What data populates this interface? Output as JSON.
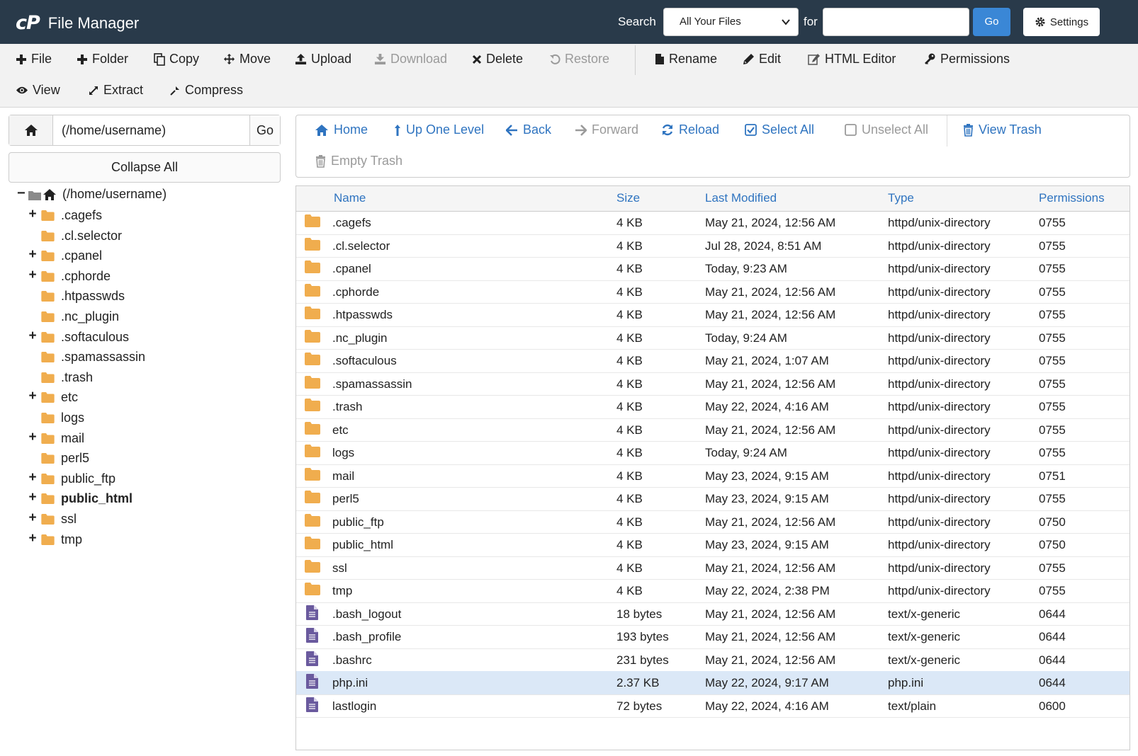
{
  "header": {
    "logo": "cP",
    "title": "File Manager",
    "search_label": "Search",
    "search_scope": "All Your Files",
    "for_label": "for",
    "search_value": "",
    "go_label": "Go",
    "settings_label": "Settings"
  },
  "toolbar": {
    "file": "File",
    "folder": "Folder",
    "copy": "Copy",
    "move": "Move",
    "upload": "Upload",
    "download": "Download",
    "delete": "Delete",
    "restore": "Restore",
    "rename": "Rename",
    "edit": "Edit",
    "html_editor": "HTML Editor",
    "permissions": "Permissions",
    "view": "View",
    "extract": "Extract",
    "compress": "Compress"
  },
  "sidebar": {
    "path_value": "(/home/username)",
    "go_label": "Go",
    "collapse_label": "Collapse All",
    "root_label": "(/home/username)",
    "tree": [
      {
        "label": ".cagefs",
        "expandable": true,
        "bold": false
      },
      {
        "label": ".cl.selector",
        "expandable": false,
        "bold": false
      },
      {
        "label": ".cpanel",
        "expandable": true,
        "bold": false
      },
      {
        "label": ".cphorde",
        "expandable": true,
        "bold": false
      },
      {
        "label": ".htpasswds",
        "expandable": false,
        "bold": false
      },
      {
        "label": ".nc_plugin",
        "expandable": false,
        "bold": false
      },
      {
        "label": ".softaculous",
        "expandable": true,
        "bold": false
      },
      {
        "label": ".spamassassin",
        "expandable": false,
        "bold": false
      },
      {
        "label": ".trash",
        "expandable": false,
        "bold": false
      },
      {
        "label": "etc",
        "expandable": true,
        "bold": false
      },
      {
        "label": "logs",
        "expandable": false,
        "bold": false
      },
      {
        "label": "mail",
        "expandable": true,
        "bold": false
      },
      {
        "label": "perl5",
        "expandable": false,
        "bold": false
      },
      {
        "label": "public_ftp",
        "expandable": true,
        "bold": false
      },
      {
        "label": "public_html",
        "expandable": true,
        "bold": true
      },
      {
        "label": "ssl",
        "expandable": true,
        "bold": false
      },
      {
        "label": "tmp",
        "expandable": true,
        "bold": false
      }
    ]
  },
  "nav": {
    "home": "Home",
    "up_one_level": "Up One Level",
    "back": "Back",
    "forward": "Forward",
    "reload": "Reload",
    "select_all": "Select All",
    "unselect_all": "Unselect All",
    "view_trash": "View Trash",
    "empty_trash": "Empty Trash"
  },
  "table": {
    "columns": {
      "name": "Name",
      "size": "Size",
      "modified": "Last Modified",
      "type": "Type",
      "permissions": "Permissions"
    },
    "rows": [
      {
        "icon": "folder-icon",
        "name": ".cagefs",
        "size": "4 KB",
        "modified": "May 21, 2024, 12:56 AM",
        "type": "httpd/unix-directory",
        "perms": "0755"
      },
      {
        "icon": "folder-icon",
        "name": ".cl.selector",
        "size": "4 KB",
        "modified": "Jul 28, 2024, 8:51 AM",
        "type": "httpd/unix-directory",
        "perms": "0755"
      },
      {
        "icon": "folder-icon",
        "name": ".cpanel",
        "size": "4 KB",
        "modified": "Today, 9:23 AM",
        "type": "httpd/unix-directory",
        "perms": "0755"
      },
      {
        "icon": "folder-icon",
        "name": ".cphorde",
        "size": "4 KB",
        "modified": "May 21, 2024, 12:56 AM",
        "type": "httpd/unix-directory",
        "perms": "0755"
      },
      {
        "icon": "folder-icon",
        "name": ".htpasswds",
        "size": "4 KB",
        "modified": "May 21, 2024, 12:56 AM",
        "type": "httpd/unix-directory",
        "perms": "0755"
      },
      {
        "icon": "folder-icon",
        "name": ".nc_plugin",
        "size": "4 KB",
        "modified": "Today, 9:24 AM",
        "type": "httpd/unix-directory",
        "perms": "0755"
      },
      {
        "icon": "folder-icon",
        "name": ".softaculous",
        "size": "4 KB",
        "modified": "May 21, 2024, 1:07 AM",
        "type": "httpd/unix-directory",
        "perms": "0755"
      },
      {
        "icon": "folder-icon",
        "name": ".spamassassin",
        "size": "4 KB",
        "modified": "May 21, 2024, 12:56 AM",
        "type": "httpd/unix-directory",
        "perms": "0755"
      },
      {
        "icon": "folder-icon",
        "name": ".trash",
        "size": "4 KB",
        "modified": "May 22, 2024, 4:16 AM",
        "type": "httpd/unix-directory",
        "perms": "0755"
      },
      {
        "icon": "folder-icon",
        "name": "etc",
        "size": "4 KB",
        "modified": "May 21, 2024, 12:56 AM",
        "type": "httpd/unix-directory",
        "perms": "0755"
      },
      {
        "icon": "folder-icon",
        "name": "logs",
        "size": "4 KB",
        "modified": "Today, 9:24 AM",
        "type": "httpd/unix-directory",
        "perms": "0755"
      },
      {
        "icon": "folder-icon",
        "name": "mail",
        "size": "4 KB",
        "modified": "May 23, 2024, 9:15 AM",
        "type": "httpd/unix-directory",
        "perms": "0751"
      },
      {
        "icon": "folder-icon",
        "name": "perl5",
        "size": "4 KB",
        "modified": "May 23, 2024, 9:15 AM",
        "type": "httpd/unix-directory",
        "perms": "0755"
      },
      {
        "icon": "folder-icon",
        "name": "public_ftp",
        "size": "4 KB",
        "modified": "May 21, 2024, 12:56 AM",
        "type": "httpd/unix-directory",
        "perms": "0750"
      },
      {
        "icon": "folder-icon",
        "name": "public_html",
        "size": "4 KB",
        "modified": "May 23, 2024, 9:15 AM",
        "type": "httpd/unix-directory",
        "perms": "0750"
      },
      {
        "icon": "folder-icon",
        "name": "ssl",
        "size": "4 KB",
        "modified": "May 21, 2024, 12:56 AM",
        "type": "httpd/unix-directory",
        "perms": "0755"
      },
      {
        "icon": "folder-icon",
        "name": "tmp",
        "size": "4 KB",
        "modified": "May 22, 2024, 2:38 PM",
        "type": "httpd/unix-directory",
        "perms": "0755"
      },
      {
        "icon": "file-icon",
        "name": ".bash_logout",
        "size": "18 bytes",
        "modified": "May 21, 2024, 12:56 AM",
        "type": "text/x-generic",
        "perms": "0644"
      },
      {
        "icon": "file-icon",
        "name": ".bash_profile",
        "size": "193 bytes",
        "modified": "May 21, 2024, 12:56 AM",
        "type": "text/x-generic",
        "perms": "0644"
      },
      {
        "icon": "file-icon",
        "name": ".bashrc",
        "size": "231 bytes",
        "modified": "May 21, 2024, 12:56 AM",
        "type": "text/x-generic",
        "perms": "0644"
      },
      {
        "icon": "file-icon",
        "name": "php.ini",
        "size": "2.37 KB",
        "modified": "May 22, 2024, 9:17 AM",
        "type": "php.ini",
        "perms": "0644",
        "selected": true
      },
      {
        "icon": "file-icon",
        "name": "lastlogin",
        "size": "72 bytes",
        "modified": "May 22, 2024, 4:16 AM",
        "type": "text/plain",
        "perms": "0600"
      }
    ]
  },
  "colors": {
    "header_bg": "#293a4a",
    "link": "#2f74c0",
    "folder": "#f0ad4e",
    "file": "#6a5a9e",
    "selected_row": "#dbe8f7",
    "go_button": "#3a87d6"
  }
}
